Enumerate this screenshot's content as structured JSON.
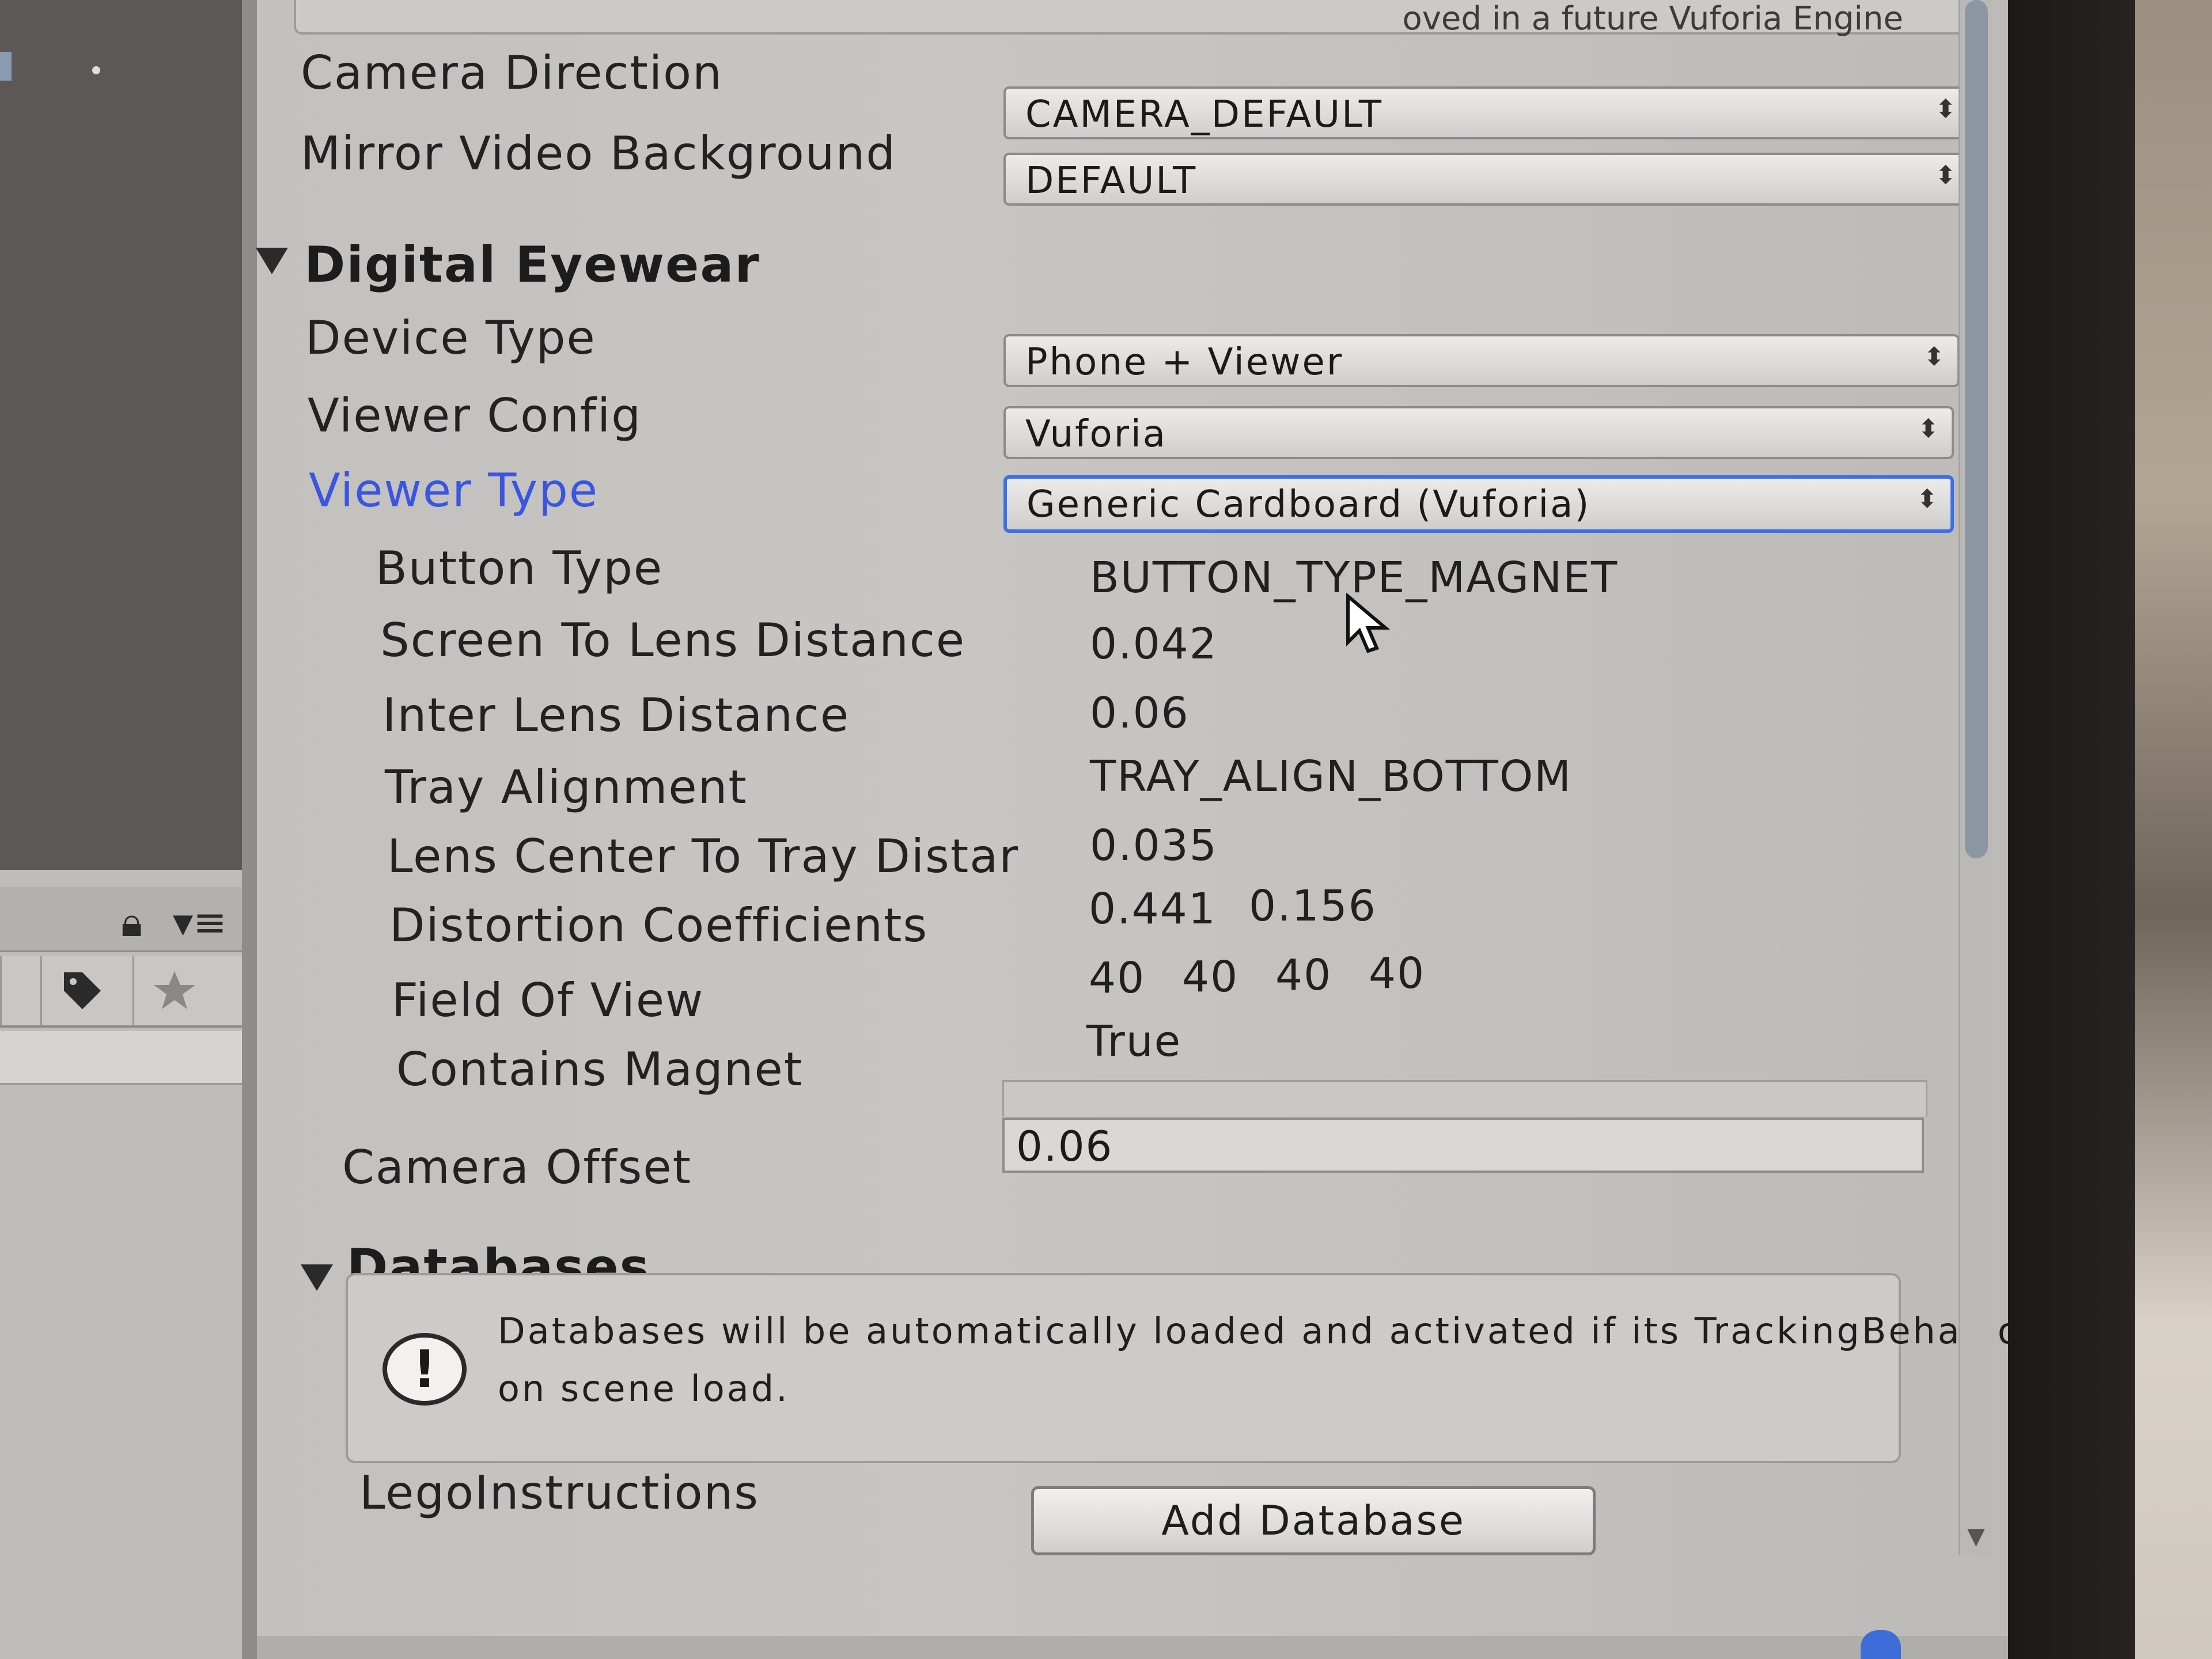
{
  "top_notice": {
    "text": "oved in a future Vuforia Engine"
  },
  "camera": {
    "direction_label": "Camera Direction",
    "direction_value": "CAMERA_DEFAULT",
    "mirror_label": "Mirror Video Background",
    "mirror_value": "DEFAULT"
  },
  "digital_eyewear": {
    "header": "Digital Eyewear",
    "device_type_label": "Device Type",
    "device_type_value": "Phone + Viewer",
    "viewer_config_label": "Viewer Config",
    "viewer_config_value": "Vuforia",
    "viewer_type_label": "Viewer Type",
    "viewer_type_value": "Generic Cardboard (Vuforia)",
    "properties": [
      {
        "label": "Button Type",
        "values": [
          "BUTTON_TYPE_MAGNET"
        ]
      },
      {
        "label": "Screen To Lens Distance",
        "values": [
          "0.042"
        ]
      },
      {
        "label": "Inter Lens Distance",
        "values": [
          "0.06"
        ]
      },
      {
        "label": "Tray Alignment",
        "values": [
          "TRAY_ALIGN_BOTTOM"
        ]
      },
      {
        "label": "Lens Center To Tray Distar",
        "values": [
          "0.035"
        ]
      },
      {
        "label": "Distortion Coefficients",
        "values": [
          "0.441",
          "0.156"
        ]
      },
      {
        "label": "Field Of View",
        "values": [
          "40",
          "40",
          "40",
          "40"
        ]
      },
      {
        "label": "Contains Magnet",
        "values": [
          "True"
        ]
      }
    ],
    "camera_offset_label": "Camera Offset",
    "camera_offset_value": "0.06"
  },
  "databases": {
    "header": "Databases",
    "help_line1": "Databases will be automatically loaded and activated if its TrackingBehaviour is enabled",
    "help_line2": "on scene load.",
    "item": "LegoInstructions",
    "add_button": "Add Database"
  },
  "icons": {
    "lock": "lock-icon",
    "menu": "menu-icon",
    "tag": "tag-icon",
    "star": "star-icon",
    "warning": "warning-icon",
    "cursor": "mouse-cursor-icon"
  },
  "colors": {
    "focus_blue": "#3d6fe8",
    "label_blue": "#3a55e0",
    "inspector_bg": "#c6c4c1"
  }
}
